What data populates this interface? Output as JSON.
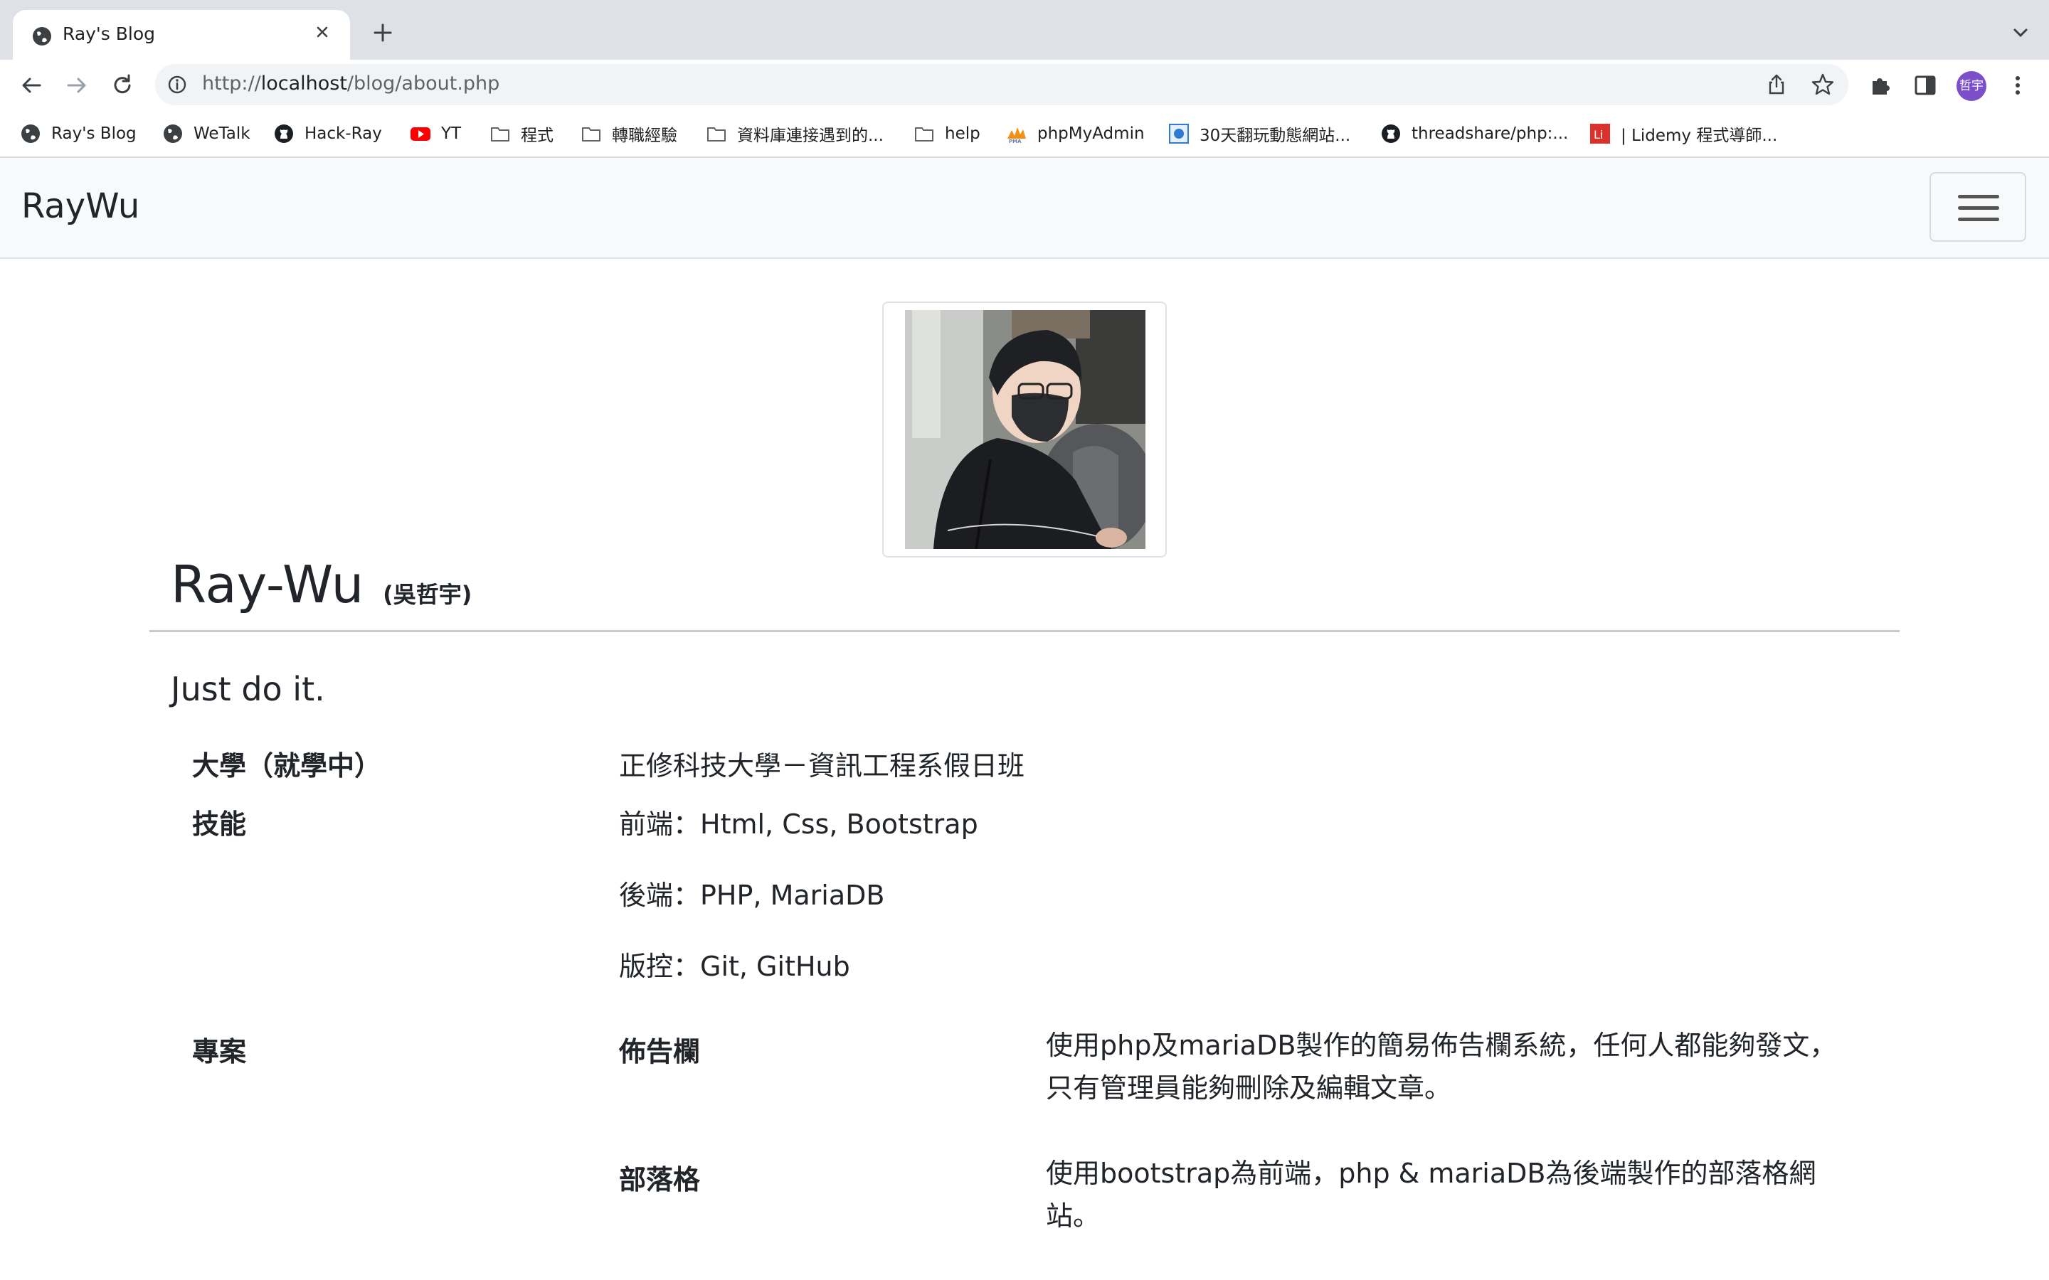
{
  "browser": {
    "tab_title": "Ray's Blog",
    "url_prefix": "http://",
    "url_host": "localhost",
    "url_path": "/blog/about.php",
    "profile_initials": "哲宇",
    "bookmarks": [
      {
        "label": "Ray's Blog",
        "icon": "globe-icon"
      },
      {
        "label": "WeTalk",
        "icon": "globe-icon"
      },
      {
        "label": "Hack-Ray",
        "icon": "github-icon"
      },
      {
        "label": "YT",
        "icon": "youtube-icon"
      },
      {
        "label": "程式",
        "icon": "folder-icon"
      },
      {
        "label": "轉職經驗",
        "icon": "folder-icon"
      },
      {
        "label": "資料庫連接遇到的...",
        "icon": "folder-icon"
      },
      {
        "label": "help",
        "icon": "folder-icon"
      },
      {
        "label": "phpMyAdmin",
        "icon": "phpmyadmin-icon"
      },
      {
        "label": "30天翻玩動態網站...",
        "icon": "site-icon"
      },
      {
        "label": "threadshare/php:...",
        "icon": "github-icon"
      },
      {
        "label": "| Lidemy 程式導師...",
        "icon": "lidemy-icon"
      }
    ]
  },
  "site": {
    "brand": "RayWu"
  },
  "profile": {
    "name": "Ray-Wu",
    "name_cn": "(吳哲宇)",
    "motto": "Just do it.",
    "university_label": "大學（就學中）",
    "university_value": "正修科技大學－資訊工程系假日班",
    "skills_label": "技能",
    "skills": [
      "前端：Html, Css, Bootstrap",
      "後端：PHP, MariaDB",
      "版控：Git, GitHub"
    ],
    "projects_label": "專案",
    "projects": [
      {
        "name": "佈告欄",
        "line1": "使用php及mariaDB製作的簡易佈告欄系統，任何人都能夠發文，",
        "line2": "只有管理員能夠刪除及編輯文章。"
      },
      {
        "name": "部落格",
        "line1": "使用bootstrap為前端，php & mariaDB為後端製作的部落格網",
        "line2": "站。"
      }
    ]
  },
  "colors": {
    "chrome_bg": "#dee1e6",
    "navbar_bg": "#f8f9fa",
    "avatar_bg": "#7a4fc9"
  }
}
